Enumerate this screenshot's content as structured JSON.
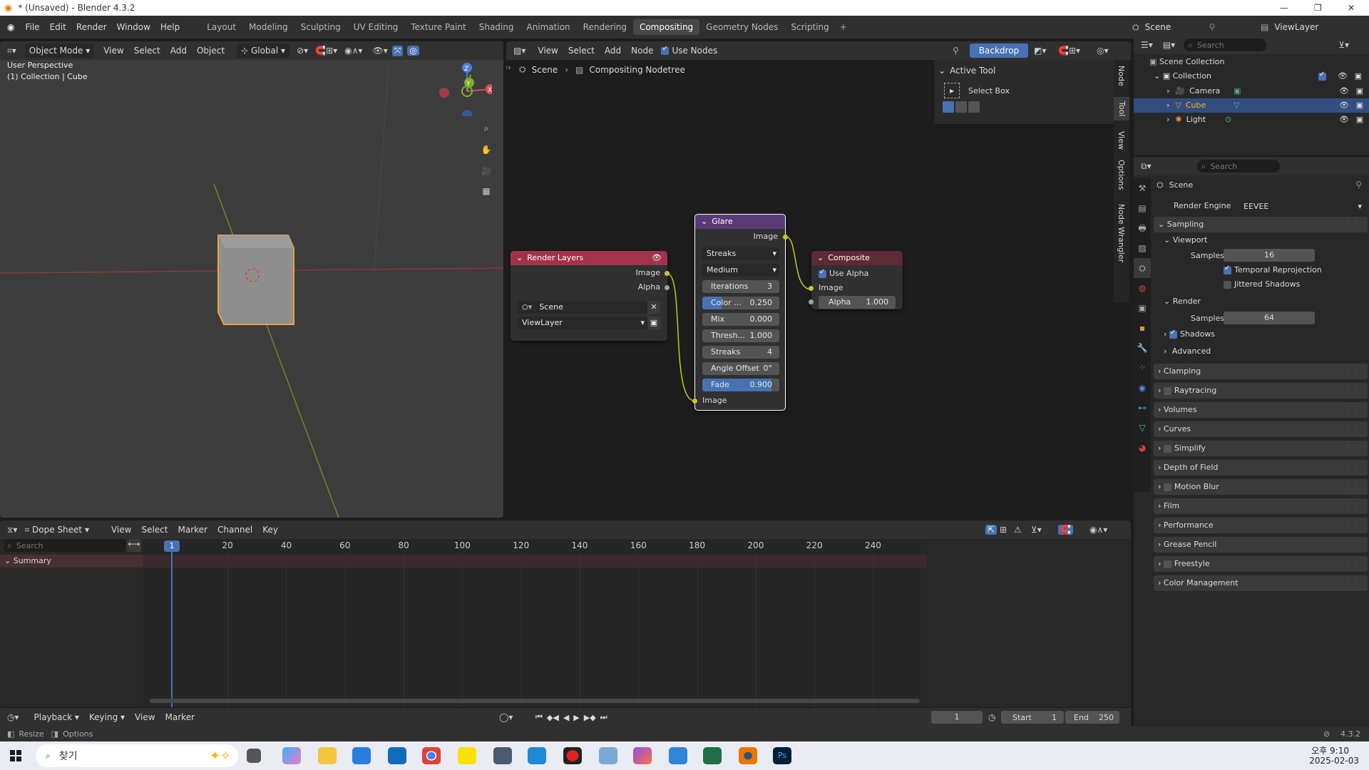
{
  "window": {
    "title": "* (Unsaved) - Blender 4.3.2"
  },
  "menu": [
    "File",
    "Edit",
    "Render",
    "Window",
    "Help"
  ],
  "workspaces": [
    "Layout",
    "Modeling",
    "Sculpting",
    "UV Editing",
    "Texture Paint",
    "Shading",
    "Animation",
    "Rendering",
    "Compositing",
    "Geometry Nodes",
    "Scripting"
  ],
  "active_workspace": "Compositing",
  "scene_name": "Scene",
  "view_layer": "ViewLayer",
  "viewport": {
    "mode": "Object Mode",
    "menus": [
      "View",
      "Select",
      "Add",
      "Object"
    ],
    "orientation": "Global",
    "info1": "User Perspective",
    "info2": "(1) Collection | Cube",
    "gizmo": {
      "x": "X",
      "y": "Y",
      "z": "Z"
    }
  },
  "node_editor": {
    "menus": [
      "View",
      "Select",
      "Add",
      "Node"
    ],
    "use_nodes": "Use Nodes",
    "backdrop": "Backdrop",
    "breadcrumb_scene": "Scene",
    "breadcrumb_tree": "Compositing Nodetree"
  },
  "render_layers_node": {
    "title": "Render Layers",
    "out_image": "Image",
    "out_alpha": "Alpha",
    "scene": "Scene",
    "layer": "ViewLayer"
  },
  "glare_node": {
    "title": "Glare",
    "out_image": "Image",
    "type": "Streaks",
    "quality": "Medium",
    "fields": [
      {
        "label": "Iterations",
        "value": "3"
      },
      {
        "label": "Color ...",
        "value": "0.250",
        "fill": 0.25
      },
      {
        "label": "Mix",
        "value": "0.000"
      },
      {
        "label": "Thresh...",
        "value": "1.000"
      },
      {
        "label": "Streaks",
        "value": "4"
      },
      {
        "label": "Angle Offset",
        "value": "0°"
      },
      {
        "label": "Fade",
        "value": "0.900",
        "fill": 0.9
      }
    ],
    "in_image": "Image"
  },
  "composite_node": {
    "title": "Composite",
    "use_alpha": "Use Alpha",
    "in_image": "Image",
    "alpha_label": "Alpha",
    "alpha_value": "1.000"
  },
  "sidebar": {
    "section": "Active Tool",
    "tool": "Select Box",
    "tabs": [
      "Node",
      "Tool",
      "View",
      "Options",
      "Node Wrangler"
    ]
  },
  "outliner": {
    "search_placeholder": "Search",
    "root": "Scene Collection",
    "collection": "Collection",
    "items": [
      "Camera",
      "Cube",
      "Light"
    ]
  },
  "properties": {
    "search_placeholder": "Search",
    "scene": "Scene",
    "render_engine_label": "Render Engine",
    "render_engine": "EEVEE",
    "sampling": "Sampling",
    "viewport": "Viewport",
    "samples_label": "Samples",
    "viewport_samples": "16",
    "temporal": "Temporal Reprojection",
    "jittered": "Jittered Shadows",
    "render": "Render",
    "render_samples": "64",
    "shadows": "Shadows",
    "advanced": "Advanced",
    "panels": [
      "Clamping",
      "Raytracing",
      "Volumes",
      "Curves",
      "Simplify",
      "Depth of Field",
      "Motion Blur",
      "Film",
      "Performance",
      "Grease Pencil",
      "Freestyle",
      "Color Management"
    ]
  },
  "dopesheet": {
    "mode": "Dope Sheet",
    "menus": [
      "View",
      "Select",
      "Marker",
      "Channel",
      "Key"
    ],
    "search_placeholder": "Search",
    "summary": "Summary",
    "ticks": [
      "20",
      "40",
      "60",
      "80",
      "100",
      "120",
      "140",
      "160",
      "180",
      "200",
      "220",
      "240"
    ],
    "current_frame": "1"
  },
  "timeline": {
    "menus": [
      "Playback",
      "Keying",
      "View",
      "Marker"
    ],
    "frame": "1",
    "start_label": "Start",
    "start": "1",
    "end_label": "End",
    "end": "250"
  },
  "statusbar": {
    "resize": "Resize",
    "options": "Options",
    "version": "4.3.2"
  },
  "taskbar": {
    "search": "찾기",
    "time": "오후 9:10",
    "date": "2025-02-03"
  }
}
